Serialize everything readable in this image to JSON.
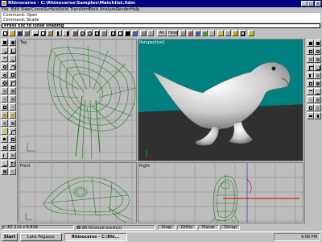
{
  "window": {
    "title": "Rhinoceros - C:\\Rhinoceros\\Samples\\Matchlist.3dm"
  },
  "menu": [
    "File",
    "Edit",
    "View",
    "Curve",
    "Surface",
    "Solid",
    "Transform",
    "Tools",
    "Analyze",
    "Render",
    "Help"
  ],
  "command_history": [
    "Command: Open",
    "Command: Shade"
  ],
  "prompt": "Press Esc to close shading",
  "toolbar": {
    "layer_label": "All",
    "hide_label": "Hide"
  },
  "viewports": {
    "top": "Top",
    "perspective": "Perspective1",
    "front": "Front",
    "right": "Right"
  },
  "status": {
    "coords": "y  -62.212    z  6.834",
    "mesh_info": "86 finished mesh(s)",
    "snap": "Snap",
    "ortho": "Ortho",
    "planar": "Planar",
    "osnap": "Osnap"
  },
  "taskbar": {
    "start": "Start",
    "task1": "Lake Pegasus",
    "task2": "Rhinoceros - C:\\Rhi...",
    "clock": "4:06 PM"
  }
}
